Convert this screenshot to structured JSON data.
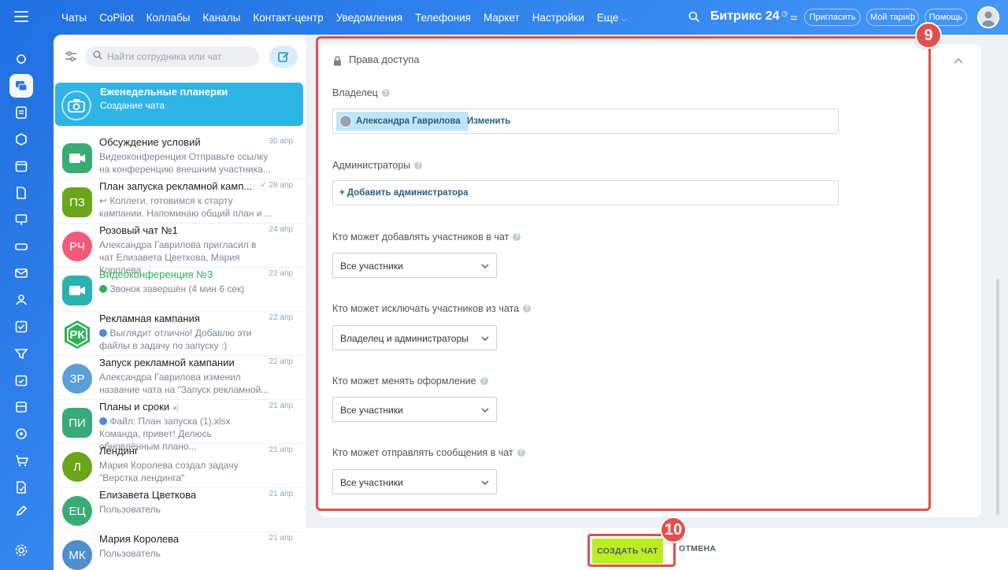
{
  "topbar": {
    "nav": [
      "Чаты",
      "CoPilot",
      "Коллабы",
      "Каналы",
      "Контакт-центр",
      "Уведомления",
      "Телефония",
      "Маркет",
      "Настройки",
      "Еще"
    ],
    "brand": "Битрикс 24",
    "invite": "Пригласить",
    "tariff": "Мой тариф",
    "help": "Помощь"
  },
  "chatlist": {
    "search_placeholder": "Найти сотрудника или чат",
    "active": {
      "title": "Еженедельные планерки",
      "subtitle": "Создание чата"
    },
    "items": [
      {
        "initials": "",
        "title": "Обсуждение условий",
        "date": "30 апр",
        "preview": "Видеоконференция Отправьте ссылку на конференцию внешним участника..."
      },
      {
        "initials": "ПЗ",
        "title": "План запуска рекламной камп...",
        "date": "28 апр",
        "preview": "↩ Коллеги, готовимся к старту кампании. Напоминаю общий план и ..."
      },
      {
        "initials": "РЧ",
        "title": "Розовый чат №1",
        "date": "24 апр",
        "preview": "Александра Гаврилова пригласил в чат Елизавета Цветкова, Мария Королева"
      },
      {
        "initials": "",
        "title": "Видеоконференция №3",
        "date": "22 апр",
        "preview": "Звонок завершён (4 мин 6 сек)"
      },
      {
        "initials": "РК",
        "title": "Рекламная кампания",
        "date": "22 апр",
        "preview": "Выглядит отлично! Добавлю эти файлы в задачу по запуску :)"
      },
      {
        "initials": "ЗР",
        "title": "Запуск рекламной кампании",
        "date": "22 апр",
        "preview": "Александра Гаврилова изменил название чата на \"Запуск рекламной..."
      },
      {
        "initials": "ПИ",
        "title": "Планы и сроки",
        "date": "21 апр",
        "preview": "Файл: План запуска (1).xlsx Команда, привет! Делюсь обновлённым плано..."
      },
      {
        "initials": "Л",
        "title": "Лендинг",
        "date": "21 апр",
        "preview": "Мария Королева создал задачу \"Верстка лендинга\""
      },
      {
        "initials": "ЕЦ",
        "title": "Елизавета Цветкова",
        "date": "21 апр",
        "preview": "Пользователь"
      },
      {
        "initials": "МК",
        "title": "Мария Королева",
        "date": "21 апр",
        "preview": "Пользователь"
      }
    ]
  },
  "access": {
    "section_title": "Права доступа",
    "owner_label": "Владелец",
    "owner_name": "Александра Гаврилова",
    "owner_change": "Изменить",
    "admins_label": "Администраторы",
    "admins_add": "+ Добавить администратора",
    "add_members_label": "Кто может добавлять участников в чат",
    "add_members_value": "Все участники",
    "remove_members_label": "Кто может исключать участников из чата",
    "remove_members_value": "Владелец и администраторы",
    "design_label": "Кто может менять оформление",
    "design_value": "Все участники",
    "send_label": "Кто может отправлять сообщения в чат",
    "send_value": "Все участники"
  },
  "actions": {
    "create": "СОЗДАТЬ ЧАТ",
    "cancel": "ОТМЕНА"
  },
  "callouts": {
    "access": "9",
    "create": "10"
  },
  "colors": {
    "accent": "#2fb4e6",
    "create_button": "#bbed21",
    "callout": "#e2504c"
  }
}
